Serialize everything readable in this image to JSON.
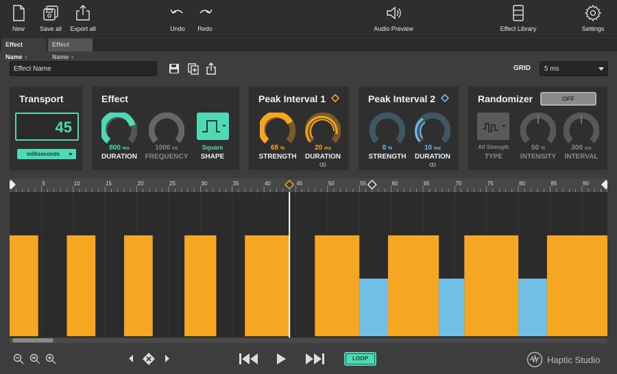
{
  "toolbar": {
    "new": "New",
    "save_all": "Save all",
    "export_all": "Export all",
    "undo": "Undo",
    "redo": "Redo",
    "audio_preview": "Audio Preview",
    "effect_library": "Effect Library",
    "settings": "Settings"
  },
  "tabs": [
    {
      "label": "Effect Name",
      "close": "×"
    },
    {
      "label": "Effect Name",
      "close": "×"
    }
  ],
  "name_field": {
    "value": "Effect Name"
  },
  "grid": {
    "label": "GRID",
    "value": "5 ms"
  },
  "transport": {
    "title": "Transport",
    "value": "45",
    "unit": "milliseconds"
  },
  "effect": {
    "title": "Effect",
    "duration": {
      "value": "800",
      "unit": "ms",
      "label": "DURATION",
      "level": 0.75
    },
    "frequency": {
      "value": "1000",
      "unit": "Hz",
      "label": "FREQUENCY",
      "level": 0.0
    },
    "shape": {
      "value": "Square",
      "label": "SHAPE"
    }
  },
  "peak1": {
    "title": "Peak Interval 1",
    "strength": {
      "value": "68",
      "unit": "%",
      "label": "STRENGTH",
      "level": 0.68
    },
    "duration": {
      "value": "20",
      "unit": "ms",
      "label": "DURATION",
      "level": 0.6
    }
  },
  "peak2": {
    "title": "Peak Interval 2",
    "strength": {
      "value": "0",
      "unit": "%",
      "label": "STRENGTH",
      "level": 0.0
    },
    "duration": {
      "value": "10",
      "unit": "ms",
      "label": "DURATION",
      "level": 0.35
    }
  },
  "randomizer": {
    "title": "Randomizer",
    "toggle": "OFF",
    "type": {
      "value": "All Strength",
      "label": "TYPE"
    },
    "intensity": {
      "value": "50",
      "unit": "%",
      "label": "INTENSITY"
    },
    "interval": {
      "value": "300",
      "unit": "ms",
      "label": "INTERVAL"
    }
  },
  "ruler": {
    "ticks": [
      "5",
      "10",
      "15",
      "20",
      "25",
      "30",
      "35",
      "40",
      "45",
      "50",
      "55",
      "60",
      "65",
      "70",
      "75",
      "80",
      "85",
      "90"
    ]
  },
  "bottom": {
    "loop": "LOOP",
    "brand": "Haptic Studio"
  },
  "colors": {
    "accent": "#4fd9b5",
    "orange": "#f5a623",
    "blue": "#74bfe6"
  },
  "chart_data": {
    "type": "bar",
    "x_unit": "ms",
    "xlim": [
      0,
      94
    ],
    "playhead": 44,
    "segments": [
      {
        "start": 0,
        "end": 4.5,
        "level": 0.7,
        "kind": "orange"
      },
      {
        "start": 9,
        "end": 13.5,
        "level": 0.7,
        "kind": "orange"
      },
      {
        "start": 18,
        "end": 22.5,
        "level": 0.7,
        "kind": "orange"
      },
      {
        "start": 27.5,
        "end": 32.5,
        "level": 0.7,
        "kind": "orange"
      },
      {
        "start": 37,
        "end": 44,
        "level": 0.7,
        "kind": "orange"
      },
      {
        "start": 48,
        "end": 55,
        "level": 0.7,
        "kind": "orange"
      },
      {
        "start": 55,
        "end": 59.5,
        "level": 0.4,
        "kind": "blue"
      },
      {
        "start": 59.5,
        "end": 67.5,
        "level": 0.7,
        "kind": "orange"
      },
      {
        "start": 67.5,
        "end": 71.5,
        "level": 0.4,
        "kind": "blue"
      },
      {
        "start": 71.5,
        "end": 80,
        "level": 0.7,
        "kind": "orange"
      },
      {
        "start": 80,
        "end": 84.5,
        "level": 0.4,
        "kind": "blue"
      },
      {
        "start": 84.5,
        "end": 94,
        "level": 0.7,
        "kind": "orange"
      }
    ]
  }
}
